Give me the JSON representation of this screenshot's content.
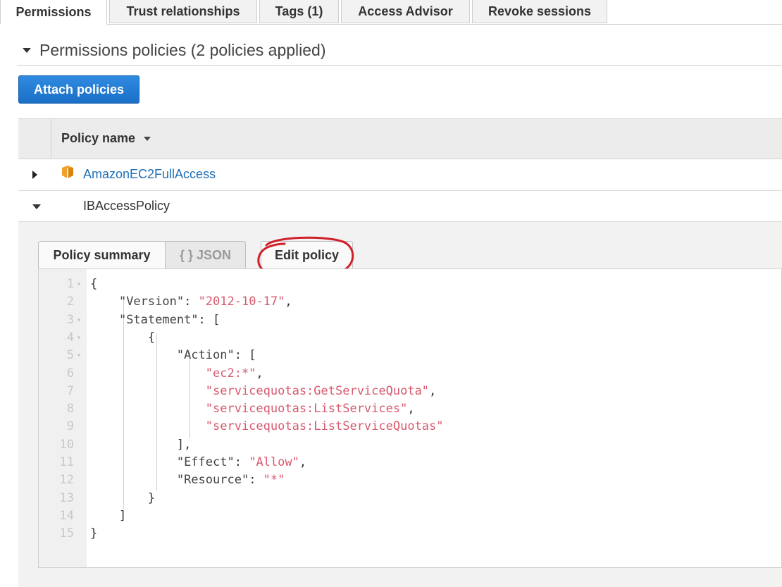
{
  "tabs": [
    {
      "label": "Permissions",
      "active": true
    },
    {
      "label": "Trust relationships",
      "active": false
    },
    {
      "label": "Tags (1)",
      "active": false
    },
    {
      "label": "Access Advisor",
      "active": false
    },
    {
      "label": "Revoke sessions",
      "active": false
    }
  ],
  "section": {
    "title": "Permissions policies (2 policies applied)"
  },
  "attach_button": "Attach policies",
  "table": {
    "column_header": "Policy name",
    "rows": [
      {
        "name": "AmazonEC2FullAccess",
        "expanded": false,
        "icon": "aws-managed-box-icon"
      },
      {
        "name": "IBAccessPolicy",
        "expanded": true
      }
    ]
  },
  "policy_view": {
    "summary_tab": "Policy summary",
    "json_tab": "{ } JSON",
    "edit_button": "Edit policy",
    "annotation_color": "#d0202a"
  },
  "editor": {
    "lines": [
      {
        "n": "1",
        "fold": true,
        "parts": [
          {
            "t": "{",
            "c": "p"
          }
        ]
      },
      {
        "n": "2",
        "fold": false,
        "parts": [
          {
            "t": "    ",
            "c": "p"
          },
          {
            "t": "\"Version\"",
            "c": "k"
          },
          {
            "t": ": ",
            "c": "p"
          },
          {
            "t": "\"2012-10-17\"",
            "c": "s"
          },
          {
            "t": ",",
            "c": "p"
          }
        ]
      },
      {
        "n": "3",
        "fold": true,
        "parts": [
          {
            "t": "    ",
            "c": "p"
          },
          {
            "t": "\"Statement\"",
            "c": "k"
          },
          {
            "t": ": [",
            "c": "p"
          }
        ]
      },
      {
        "n": "4",
        "fold": true,
        "parts": [
          {
            "t": "        {",
            "c": "p"
          }
        ]
      },
      {
        "n": "5",
        "fold": true,
        "parts": [
          {
            "t": "            ",
            "c": "p"
          },
          {
            "t": "\"Action\"",
            "c": "k"
          },
          {
            "t": ": [",
            "c": "p"
          }
        ]
      },
      {
        "n": "6",
        "fold": false,
        "parts": [
          {
            "t": "                ",
            "c": "p"
          },
          {
            "t": "\"ec2:*\"",
            "c": "s"
          },
          {
            "t": ",",
            "c": "p"
          }
        ]
      },
      {
        "n": "7",
        "fold": false,
        "parts": [
          {
            "t": "                ",
            "c": "p"
          },
          {
            "t": "\"servicequotas:GetServiceQuota\"",
            "c": "s"
          },
          {
            "t": ",",
            "c": "p"
          }
        ]
      },
      {
        "n": "8",
        "fold": false,
        "parts": [
          {
            "t": "                ",
            "c": "p"
          },
          {
            "t": "\"servicequotas:ListServices\"",
            "c": "s"
          },
          {
            "t": ",",
            "c": "p"
          }
        ]
      },
      {
        "n": "9",
        "fold": false,
        "parts": [
          {
            "t": "                ",
            "c": "p"
          },
          {
            "t": "\"servicequotas:ListServiceQuotas\"",
            "c": "s"
          }
        ]
      },
      {
        "n": "10",
        "fold": false,
        "parts": [
          {
            "t": "            ],",
            "c": "p"
          }
        ]
      },
      {
        "n": "11",
        "fold": false,
        "parts": [
          {
            "t": "            ",
            "c": "p"
          },
          {
            "t": "\"Effect\"",
            "c": "k"
          },
          {
            "t": ": ",
            "c": "p"
          },
          {
            "t": "\"Allow\"",
            "c": "s"
          },
          {
            "t": ",",
            "c": "p"
          }
        ]
      },
      {
        "n": "12",
        "fold": false,
        "parts": [
          {
            "t": "            ",
            "c": "p"
          },
          {
            "t": "\"Resource\"",
            "c": "k"
          },
          {
            "t": ": ",
            "c": "p"
          },
          {
            "t": "\"*\"",
            "c": "s"
          }
        ]
      },
      {
        "n": "13",
        "fold": false,
        "parts": [
          {
            "t": "        }",
            "c": "p"
          }
        ]
      },
      {
        "n": "14",
        "fold": false,
        "parts": [
          {
            "t": "    ]",
            "c": "p"
          }
        ]
      },
      {
        "n": "15",
        "fold": false,
        "parts": [
          {
            "t": "}",
            "c": "p"
          }
        ]
      }
    ]
  }
}
